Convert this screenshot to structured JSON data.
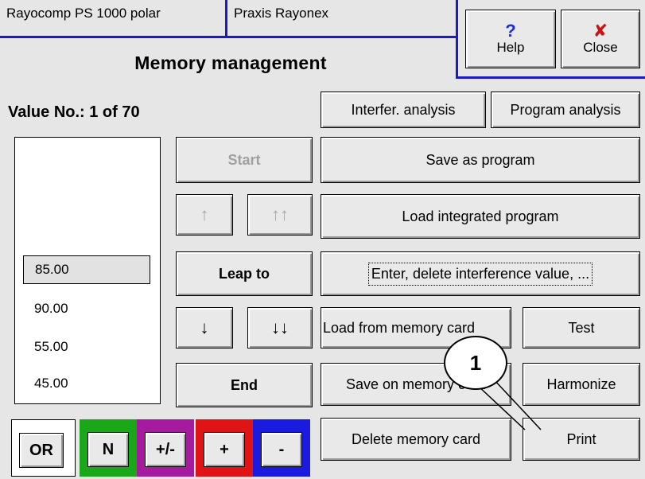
{
  "header": {
    "tab1": "Rayocomp PS 1000 polar",
    "tab2": "Praxis Rayonex",
    "title": "Memory management",
    "help_label": "Help",
    "close_label": "Close"
  },
  "value_counter": "Value No.: 1 of 70",
  "list": {
    "items": [
      {
        "label": "85.00",
        "selected": true
      },
      {
        "label": "90.00",
        "selected": false
      },
      {
        "label": "55.00",
        "selected": false
      },
      {
        "label": "45.00",
        "selected": false
      }
    ]
  },
  "controls": {
    "start": "Start",
    "leap_to": "Leap to",
    "end": "End",
    "up_icon": "↑",
    "up_up_icon": "↑↑",
    "down_icon": "↓",
    "down_down_icon": "↓↓"
  },
  "actions": {
    "interfer_analysis": "Interfer. analysis",
    "program_analysis": "Program analysis",
    "save_as_program": "Save as program",
    "load_integrated_program": "Load integrated program",
    "enter_delete": "Enter, delete interference value, ...",
    "load_from_memory_card": "Load from memory card",
    "test": "Test",
    "save_on_memory_card": "Save on memory card",
    "harmonize": "Harmonize",
    "delete_memory_card": "Delete memory card",
    "print": "Print"
  },
  "mode_buttons": {
    "or": "OR",
    "n": "N",
    "plus_minus": "+/-",
    "plus": "+",
    "minus": "-"
  },
  "colors": {
    "frame_border_blue": "#1b1bc4",
    "n_frame": "#1aa81a",
    "plus_minus_frame": "#a51a9e",
    "plus_frame": "#e01414",
    "minus_frame": "#1b1be0"
  },
  "annotation": {
    "callout_number": "1"
  }
}
